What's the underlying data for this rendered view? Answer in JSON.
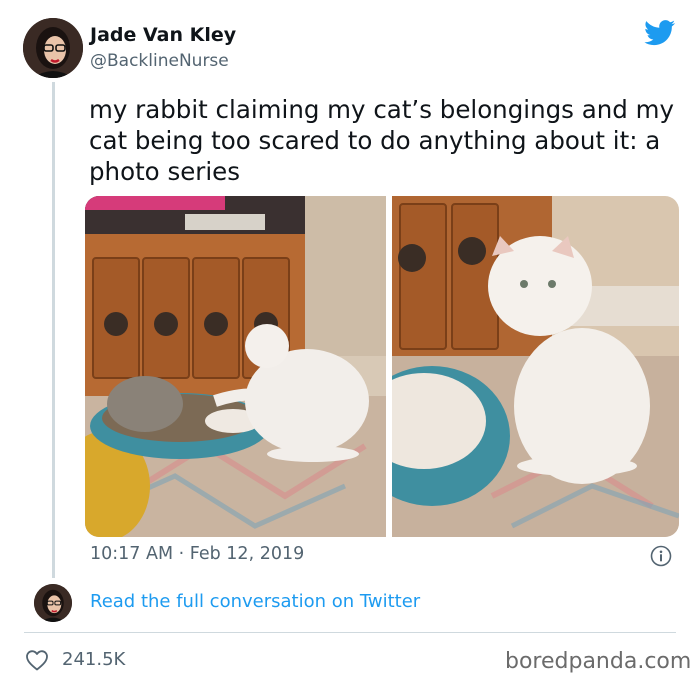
{
  "author": {
    "name": "Jade Van Kley",
    "handle": "@BacklineNurse"
  },
  "tweet": {
    "text": "my rabbit claiming my cat’s belongings and my cat being too scared to do anything about it: a photo series",
    "timestamp": "10:17 AM · Feb 12, 2019"
  },
  "conversation_link": "Read the full conversation on Twitter",
  "likes": "241.5K",
  "watermark": "boredpanda.com",
  "icons": {
    "brand": "twitter-bird-icon",
    "info": "info-icon",
    "like": "heart-icon"
  },
  "colors": {
    "twitter_blue": "#1d9bf0",
    "text_primary": "#0f1419",
    "text_secondary": "#536471",
    "divider": "#cfd9de"
  }
}
